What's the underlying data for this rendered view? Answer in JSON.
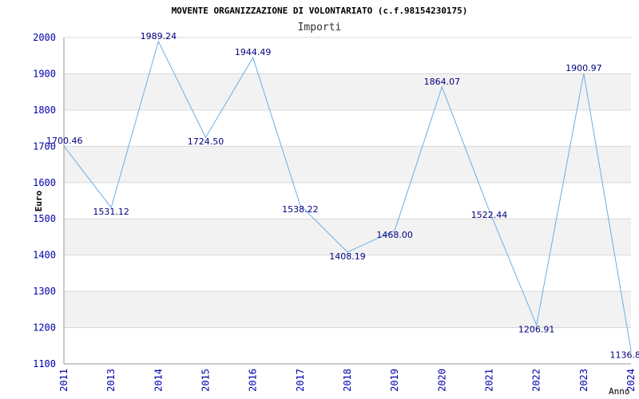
{
  "chart_data": {
    "type": "line",
    "title": "MOVENTE ORGANIZZAZIONE DI VOLONTARIATO (c.f.98154230175)",
    "subtitle": "Importi",
    "xlabel": "Anno",
    "ylabel": "Euro",
    "categories": [
      "2011",
      "2013",
      "2014",
      "2015",
      "2016",
      "2017",
      "2018",
      "2019",
      "2020",
      "2021",
      "2022",
      "2023",
      "2024"
    ],
    "values": [
      1700.46,
      1531.12,
      1989.24,
      1724.5,
      1944.49,
      1538.22,
      1408.19,
      1468.0,
      1864.07,
      1522.44,
      1206.91,
      1900.97,
      1136.8
    ],
    "value_labels": [
      "1700.46",
      "1531.12",
      "1989.24",
      "1724.50",
      "1944.49",
      "1538.22",
      "1408.19",
      "1468.00",
      "1864.07",
      "1522.44",
      "1206.91",
      "1900.97",
      "1136.8"
    ],
    "yticks": [
      "1100",
      "1200",
      "1300",
      "1400",
      "1500",
      "1600",
      "1700",
      "1800",
      "1900",
      "2000"
    ],
    "ylim": [
      1100,
      2000
    ],
    "grid": "horizontal alternating bands",
    "colors": {
      "line": "#6aaee8",
      "axis_text": "#0000aa",
      "label_text": "#000080",
      "band": "#f2f2f2",
      "grid": "#d8d8d8"
    }
  }
}
